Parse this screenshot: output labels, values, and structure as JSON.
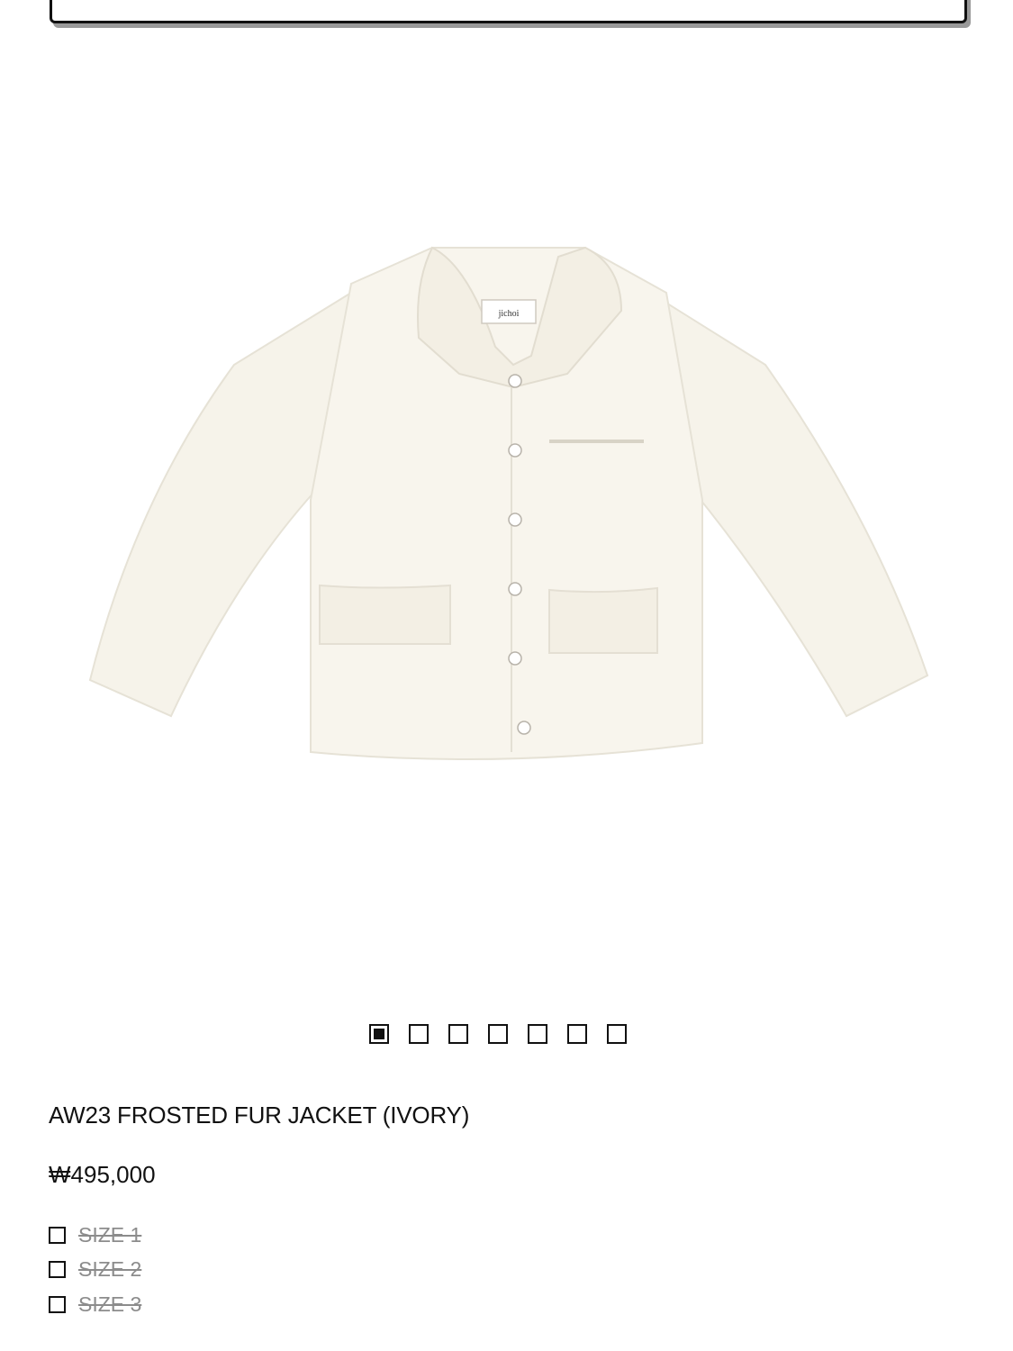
{
  "product": {
    "title": "AW23 FROSTED FUR JACKET (IVORY)",
    "price": "₩495,000",
    "label_text": "jichoi",
    "image_name": "ivory-fur-jacket-image"
  },
  "gallery": {
    "count": 7,
    "active_index": 0
  },
  "sizes": [
    {
      "label": "SIZE 1",
      "sold_out": true
    },
    {
      "label": "SIZE 2",
      "sold_out": true
    },
    {
      "label": "SIZE 3",
      "sold_out": true
    }
  ],
  "colors": {
    "jacket": "#f6f3ea",
    "jacket_shadow": "#e6e2d6",
    "text": "#111111",
    "disabled_text": "#8c8c8c"
  }
}
